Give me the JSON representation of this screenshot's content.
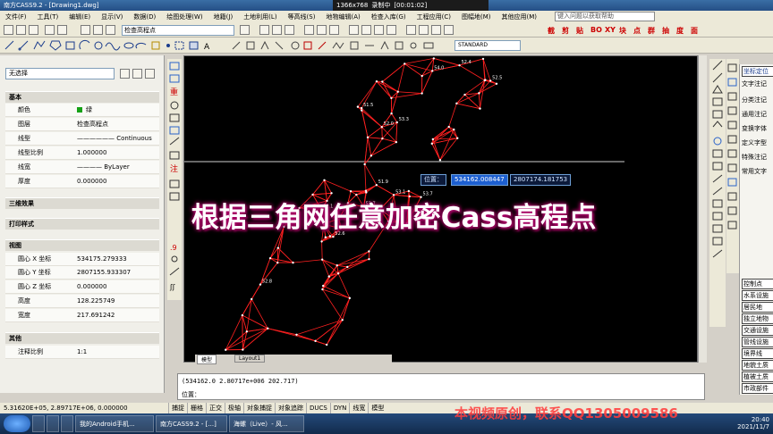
{
  "window": {
    "title": "南方CASS9.2 - [Drawing1.dwg]",
    "recorder": [
      "1366x768",
      "录制中",
      "[00:01:02]"
    ]
  },
  "menu": {
    "items": [
      "文件(F)",
      "工具(T)",
      "编辑(E)",
      "显示(V)",
      "数据(D)",
      "绘图处理(W)",
      "地籍(J)",
      "土地利用(L)",
      "等高线(S)",
      "地物编辑(A)",
      "检查入库(G)",
      "工程应用(C)",
      "图幅地(M)",
      "其他应用(M)"
    ],
    "help_placeholder": "键入问题以获取帮助"
  },
  "toolbar": {
    "layer": "检查高程点",
    "style": "STANDARD",
    "red_tools": [
      "截",
      "剪",
      "贴",
      "BO",
      "XY",
      "块",
      "点",
      "群",
      "抽",
      "度",
      "面"
    ]
  },
  "properties": {
    "selection": "无选择",
    "sections": {
      "basic": "基本",
      "3d": "三维效果",
      "print": "打印样式",
      "view": "视图",
      "other": "其他"
    },
    "basic_rows": [
      {
        "key": "颜色",
        "value": "绿"
      },
      {
        "key": "图层",
        "value": "检查高程点"
      },
      {
        "key": "线型",
        "value": "Continuous"
      },
      {
        "key": "线型比例",
        "value": "1.000000"
      },
      {
        "key": "线宽",
        "value": "ByLayer"
      },
      {
        "key": "厚度",
        "value": "0.000000"
      }
    ],
    "view_rows": [
      {
        "key": "圆心 X 坐标",
        "value": "534175.279333"
      },
      {
        "key": "圆心 Y 坐标",
        "value": "2807155.933307"
      },
      {
        "key": "圆心 Z 坐标",
        "value": "0.000000"
      },
      {
        "key": "高度",
        "value": "128.225749"
      },
      {
        "key": "宽度",
        "value": "217.691242"
      }
    ],
    "other_rows": [
      {
        "key": "注释比例",
        "value": "1:1"
      }
    ],
    "accent_color": "#16a116"
  },
  "canvas": {
    "position_label": "位置：",
    "pos_x": "534162.008447",
    "pos_y": "2807174.181753",
    "points": [
      "53.7",
      "52.1",
      "51.9",
      "52.5",
      "54.0",
      "52.8",
      "53.3",
      "52.6",
      "51.5",
      "52.0",
      "53.1",
      "52.4"
    ]
  },
  "layout_tabs": [
    "模型",
    "Layout1"
  ],
  "command": {
    "line1": "(534162.0 2.80717e+006 202.717)",
    "line2": "位置："
  },
  "status": {
    "coords": "5.31620E+05, 2.89717E+06, 0.000000",
    "buttons": [
      "捕捉",
      "栅格",
      "正交",
      "极轴",
      "对象捕捉",
      "对象追踪",
      "DUCS",
      "DYN",
      "线宽",
      "模型"
    ]
  },
  "right_panel": {
    "top_items": [
      "坐标定位",
      "文字注记",
      "分类注记",
      "通用注记",
      "变换字体",
      "定义字型",
      "特殊注记",
      "常用文字"
    ],
    "bottom_items": [
      "控制点",
      "水系设施",
      "居民地",
      "独立地物",
      "交通设施",
      "管线设施",
      "境界线",
      "地貌土质",
      "植被土质",
      "市政部件"
    ]
  },
  "taskbar": {
    "tasks": [
      "我的Android手机...",
      "南方CASS9.2 - [...]",
      "海螺（Live）- 风..."
    ],
    "time": "20:40",
    "date": "2021/11/7"
  },
  "overlay": {
    "title": "根据三角网任意加密Cass高程点",
    "watermark": "本视频原创，联系QQ1305009586"
  },
  "colors": {
    "canvas_bg": "#000000",
    "tin_lines": "#ff2020",
    "title_glow": "#b0006a"
  }
}
